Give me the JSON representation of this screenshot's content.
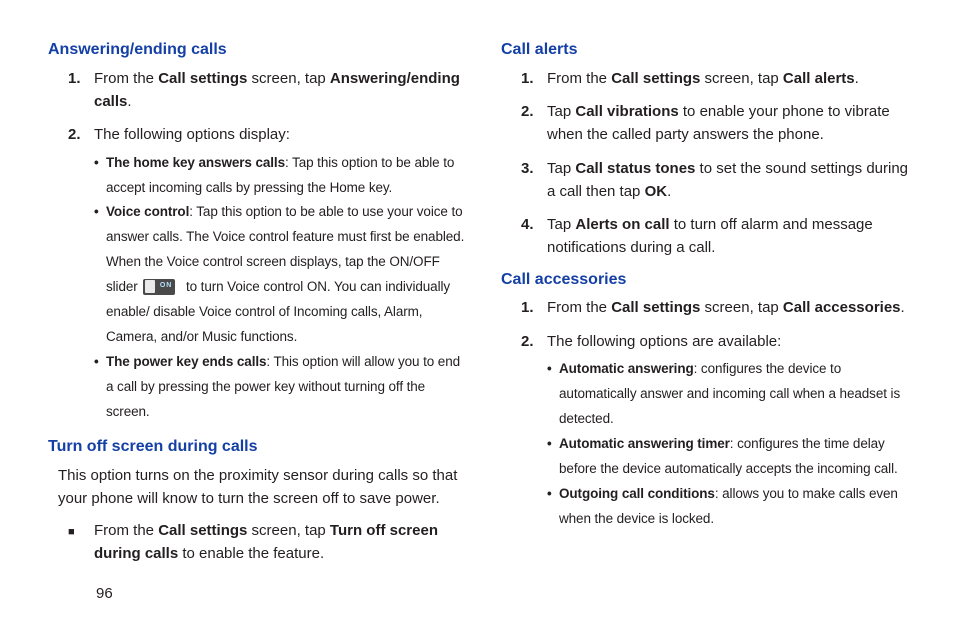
{
  "left": {
    "section1": {
      "title": "Answering/ending calls",
      "items": [
        {
          "num": "1.",
          "pre": "From the ",
          "b1": "Call settings",
          "mid": " screen, tap ",
          "b2": "Answering/ending calls",
          "post": "."
        },
        {
          "num": "2.",
          "text": "The following options display:",
          "bullets": [
            {
              "b": "The home key answers calls",
              "t": ": Tap this option to be able to accept incoming calls by pressing the Home key."
            },
            {
              "b": "Voice control",
              "t1": ": Tap this option to be able to use your voice to answer calls. The Voice control feature must first be enabled. When the Voice control screen displays, tap the ON/OFF slider ",
              "t2": " to turn Voice control ON. You can individually enable/ disable Voice control of Incoming calls, Alarm, Camera, and/or Music functions."
            },
            {
              "b": "The power key ends calls",
              "t": ": This option will allow you to end a call by pressing the power key without turning off the screen."
            }
          ]
        }
      ]
    },
    "section2": {
      "title": "Turn off screen during calls",
      "para": "This option turns on the proximity sensor during calls so that your phone will know to turn the screen off to save power.",
      "square": {
        "pre": "From the ",
        "b1": "Call settings",
        "mid": " screen, tap ",
        "b2": "Turn off screen during calls",
        "post": " to enable the feature."
      }
    }
  },
  "right": {
    "section1": {
      "title": "Call alerts",
      "items": [
        {
          "num": "1.",
          "pre": "From the ",
          "b1": "Call settings",
          "mid": " screen, tap ",
          "b2": "Call alerts",
          "post": "."
        },
        {
          "num": "2.",
          "pre": "Tap ",
          "b1": "Call vibrations",
          "post": " to enable your phone to vibrate when the called party answers the phone."
        },
        {
          "num": "3.",
          "pre": "Tap ",
          "b1": "Call status tones",
          "mid": " to set the sound settings during a call then tap ",
          "b2": "OK",
          "post": "."
        },
        {
          "num": "4.",
          "pre": "Tap ",
          "b1": "Alerts on call",
          "post": " to turn off alarm and message notifications during a call."
        }
      ]
    },
    "section2": {
      "title": "Call accessories",
      "items": [
        {
          "num": "1.",
          "pre": "From the ",
          "b1": "Call settings",
          "mid": " screen, tap ",
          "b2": "Call accessories",
          "post": "."
        },
        {
          "num": "2.",
          "text": "The following options are available:",
          "bullets": [
            {
              "b": "Automatic answering",
              "t": ": configures the device to automatically answer and incoming call when a headset is detected."
            },
            {
              "b": "Automatic answering timer",
              "t": ": configures the time delay before the device automatically accepts the incoming call."
            },
            {
              "b": "Outgoing call conditions",
              "t": ": allows you to make calls even when the device is locked."
            }
          ]
        }
      ]
    }
  },
  "pageNumber": "96"
}
